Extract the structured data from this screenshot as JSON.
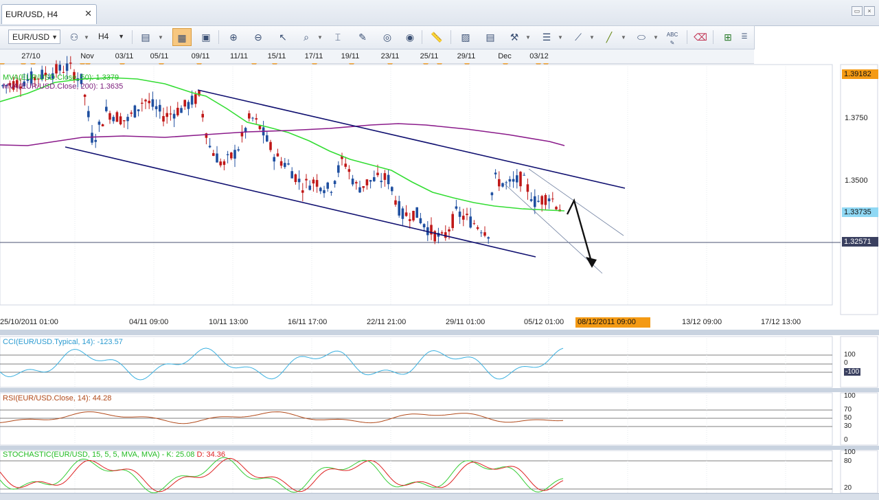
{
  "tab": {
    "title": "EUR/USD, H4",
    "close": "✕"
  },
  "toolbar": {
    "symbol": "EUR/USD",
    "timeframe": "H4",
    "icons": [
      "symbol-info-icon",
      "candles-icon",
      "bars-icon",
      "line-chart-icon",
      "magnifier-icon",
      "zoom-in-icon",
      "zoom-out-icon",
      "cursor-icon",
      "crosshair-icon",
      "ruler-icon",
      "pencil-icon",
      "color-icon",
      "globe-icon",
      "measure-icon",
      "image-icon",
      "templates-icon",
      "tools-icon",
      "menu-lines-icon",
      "brush-icon",
      "line-draw-icon",
      "ellipse-icon",
      "text-abc-icon",
      "eraser-icon",
      "hierarchy-icon"
    ]
  },
  "date_strip": [
    "27/10",
    "Nov",
    "03/11",
    "05/11",
    "09/11",
    "11/11",
    "15/11",
    "17/11",
    "19/11",
    "23/11",
    "25/11",
    "29/11",
    "Dec",
    "03/12"
  ],
  "price_axis": {
    "ticks": [
      "1.3750",
      "1.3500"
    ],
    "top_box": "1.39182",
    "current_box": "1.33735",
    "line_box": "1.32571"
  },
  "time_axis": [
    "25/10/2011 01:00",
    "04/11 09:00",
    "10/11 13:00",
    "16/11 17:00",
    "22/11 21:00",
    "29/11 01:00",
    "05/12 01:00",
    "13/12 09:00",
    "17/12 13:00"
  ],
  "time_cursor": "08/12/2011 09:00",
  "indicators_main": {
    "mva50": "MVA(EUR/USD.Close, 50): 1.3379",
    "mva200": "MVA(EUR/USD.Close, 200): 1.3635"
  },
  "cci": {
    "label": "CCI(EUR/USD.Typical, 14): -123.57",
    "levels": [
      "100",
      "0",
      "-100"
    ]
  },
  "rsi": {
    "label": "RSI(EUR/USD.Close, 14): 44.28",
    "levels": [
      "100",
      "70",
      "50",
      "30",
      "0"
    ]
  },
  "stochastic": {
    "label_prefix": "STOCHASTIC(EUR/USD, 15, 5, 5, MVA, MVA) -",
    "k": "K: 25.08",
    "d": "D: 34.36",
    "levels": [
      "100",
      "80",
      "20"
    ]
  },
  "colors": {
    "mva50": "#33dd33",
    "mva200": "#8a1a8a",
    "channel": "#101070",
    "candle_up": "#1f4fa0",
    "candle_down": "#c01818",
    "cci": "#3ab0e0",
    "rsi": "#b04818",
    "stoch_k": "#33cc33",
    "stoch_d": "#dd2020",
    "accent": "#f49a14"
  }
}
